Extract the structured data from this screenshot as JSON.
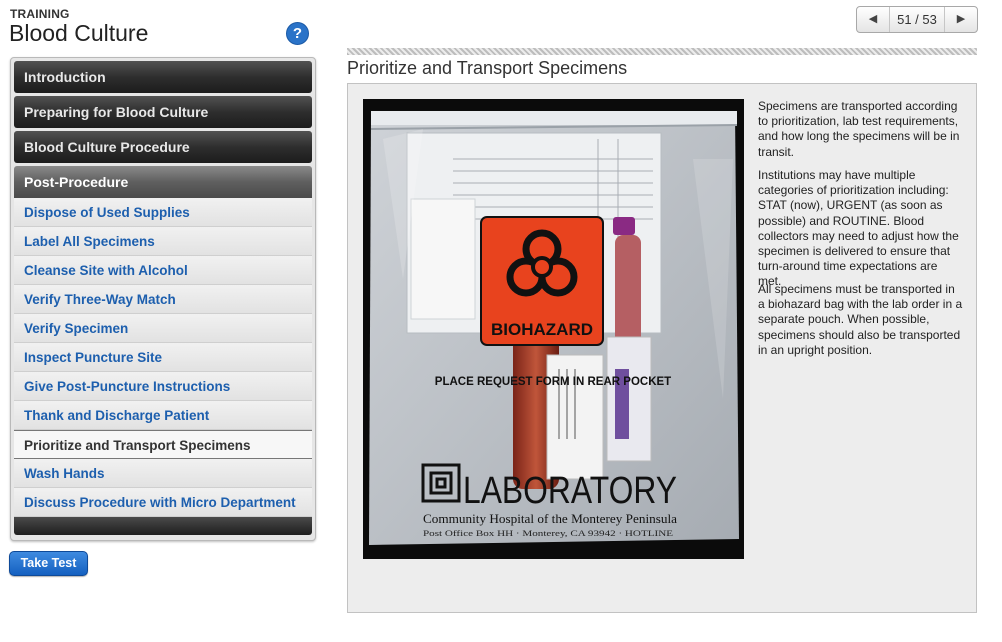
{
  "header": {
    "overline": "TRAINING",
    "title": "Blood Culture",
    "help": "?"
  },
  "pager": {
    "prev_icon": "triangle-left-icon",
    "next_icon": "triangle-right-icon",
    "count": "51 / 53"
  },
  "nav": {
    "sections": [
      "Introduction",
      "Preparing for Blood Culture",
      "Blood Culture Procedure",
      "Post-Procedure"
    ],
    "items": [
      "Dispose of Used Supplies",
      "Label All Specimens",
      "Cleanse Site with Alcohol",
      "Verify Three-Way Match",
      "Verify Specimen",
      "Inspect Puncture Site",
      "Give Post-Puncture Instructions",
      "Thank and Discharge Patient",
      "Prioritize and Transport Specimens",
      "Wash Hands",
      "Discuss Procedure with Micro Department"
    ],
    "current_index": 8
  },
  "take_test": "Take Test",
  "page": {
    "title": "Prioritize and Transport Specimens",
    "paragraphs": [
      "Specimens are transported according to prioritization, lab test requirements, and how long the specimens will be in transit.",
      "Institutions may have multiple categories of prioritization including: STAT (now), URGENT (as soon as possible) and ROUTINE. Blood collectors may need to adjust how the specimen is delivered to ensure that turn-around time expectations are met.",
      "All specimens must be transported in a biohazard bag with the lab order in a separate pouch. When possible, specimens should also be transported in an upright position."
    ]
  },
  "photo": {
    "label_biohazard": "BIOHAZARD",
    "label_pocket": "PLACE REQUEST FORM IN REAR POCKET",
    "label_lab": "LABORATORY",
    "label_hospital": "Community Hospital of the Monterey Peninsula",
    "label_address": "Post Office Box HH · Monterey, CA 93942 · HOTLINE"
  },
  "colors": {
    "link": "#1d5fae",
    "accent_blue": "#2a73c8",
    "biohazard_orange": "#e8431e"
  }
}
